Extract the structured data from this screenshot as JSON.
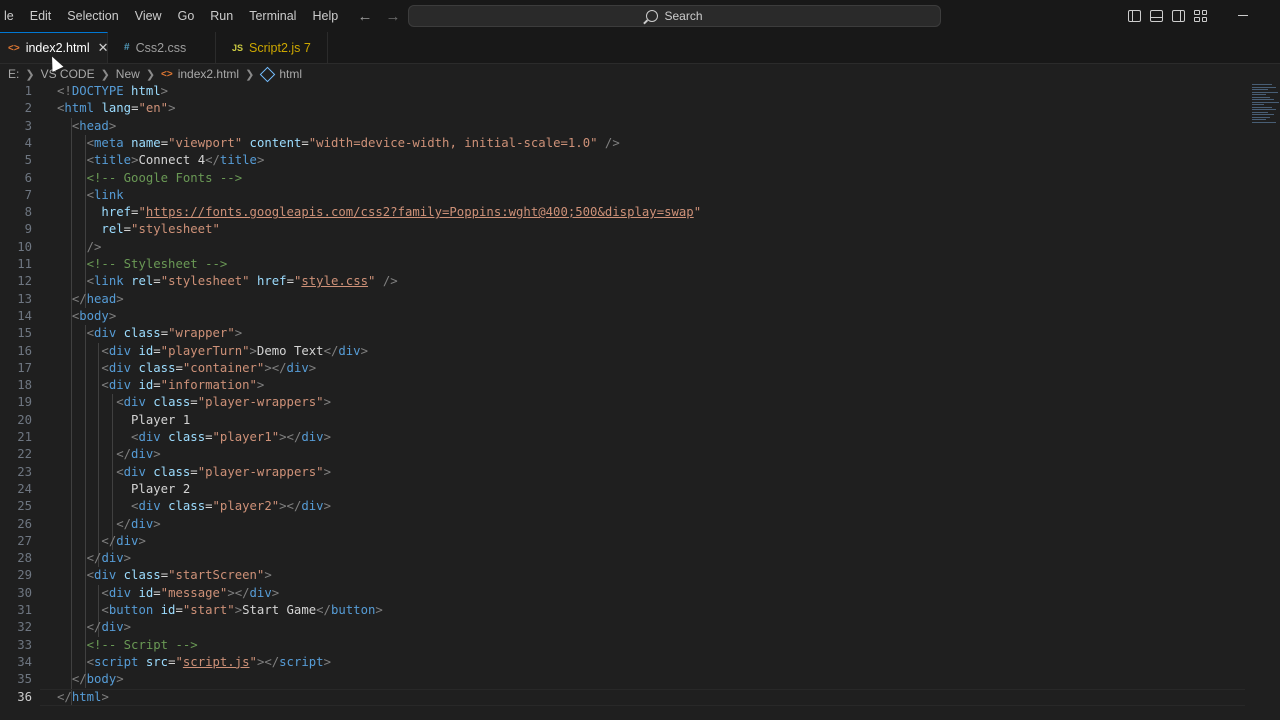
{
  "menu": [
    "le",
    "Edit",
    "Selection",
    "View",
    "Go",
    "Run",
    "Terminal",
    "Help"
  ],
  "search": {
    "label": "Search"
  },
  "tabs": [
    {
      "label": "index2.html",
      "icon": "html-file-icon",
      "active": true
    },
    {
      "label": "Css2.css",
      "icon": "css-file-icon",
      "active": false
    },
    {
      "label": "Script2.js 7",
      "icon": "js-file-icon",
      "active": false
    }
  ],
  "breadcrumb": [
    "E:",
    "VS CODE",
    "New",
    "index2.html",
    "html"
  ],
  "current_line": 36,
  "code": [
    [
      [
        "t",
        "<!"
      ],
      [
        "n",
        "DOCTYPE"
      ],
      [
        "x",
        " "
      ],
      [
        "a",
        "html"
      ],
      [
        "t",
        ">"
      ]
    ],
    [
      [
        "t",
        "<"
      ],
      [
        "n",
        "html"
      ],
      [
        "x",
        " "
      ],
      [
        "a",
        "lang"
      ],
      [
        "x",
        "="
      ],
      [
        "s",
        "\"en\""
      ],
      [
        "t",
        ">"
      ]
    ],
    [
      [
        "x",
        "  "
      ],
      [
        "t",
        "<"
      ],
      [
        "n",
        "head"
      ],
      [
        "t",
        ">"
      ]
    ],
    [
      [
        "x",
        "    "
      ],
      [
        "t",
        "<"
      ],
      [
        "n",
        "meta"
      ],
      [
        "x",
        " "
      ],
      [
        "a",
        "name"
      ],
      [
        "x",
        "="
      ],
      [
        "s",
        "\"viewport\""
      ],
      [
        "x",
        " "
      ],
      [
        "a",
        "content"
      ],
      [
        "x",
        "="
      ],
      [
        "s",
        "\"width=device-width, initial-scale=1.0\""
      ],
      [
        "x",
        " "
      ],
      [
        "t",
        "/>"
      ]
    ],
    [
      [
        "x",
        "    "
      ],
      [
        "t",
        "<"
      ],
      [
        "n",
        "title"
      ],
      [
        "t",
        ">"
      ],
      [
        "x",
        "Connect 4"
      ],
      [
        "t",
        "</"
      ],
      [
        "n",
        "title"
      ],
      [
        "t",
        ">"
      ]
    ],
    [
      [
        "x",
        "    "
      ],
      [
        "c",
        "<!-- Google Fonts -->"
      ]
    ],
    [
      [
        "x",
        "    "
      ],
      [
        "t",
        "<"
      ],
      [
        "n",
        "link"
      ]
    ],
    [
      [
        "x",
        "      "
      ],
      [
        "a",
        "href"
      ],
      [
        "x",
        "="
      ],
      [
        "s",
        "\""
      ],
      [
        "u",
        "https://fonts.googleapis.com/css2?family=Poppins:wght@400;500&display=swap"
      ],
      [
        "s",
        "\""
      ]
    ],
    [
      [
        "x",
        "      "
      ],
      [
        "a",
        "rel"
      ],
      [
        "x",
        "="
      ],
      [
        "s",
        "\"stylesheet\""
      ]
    ],
    [
      [
        "x",
        "    "
      ],
      [
        "t",
        "/>"
      ]
    ],
    [
      [
        "x",
        "    "
      ],
      [
        "c",
        "<!-- Stylesheet -->"
      ]
    ],
    [
      [
        "x",
        "    "
      ],
      [
        "t",
        "<"
      ],
      [
        "n",
        "link"
      ],
      [
        "x",
        " "
      ],
      [
        "a",
        "rel"
      ],
      [
        "x",
        "="
      ],
      [
        "s",
        "\"stylesheet\""
      ],
      [
        "x",
        " "
      ],
      [
        "a",
        "href"
      ],
      [
        "x",
        "="
      ],
      [
        "s",
        "\""
      ],
      [
        "u",
        "style.css"
      ],
      [
        "s",
        "\""
      ],
      [
        "x",
        " "
      ],
      [
        "t",
        "/>"
      ]
    ],
    [
      [
        "x",
        "  "
      ],
      [
        "t",
        "</"
      ],
      [
        "n",
        "head"
      ],
      [
        "t",
        ">"
      ]
    ],
    [
      [
        "x",
        "  "
      ],
      [
        "t",
        "<"
      ],
      [
        "n",
        "body"
      ],
      [
        "t",
        ">"
      ]
    ],
    [
      [
        "x",
        "    "
      ],
      [
        "t",
        "<"
      ],
      [
        "n",
        "div"
      ],
      [
        "x",
        " "
      ],
      [
        "a",
        "class"
      ],
      [
        "x",
        "="
      ],
      [
        "s",
        "\"wrapper\""
      ],
      [
        "t",
        ">"
      ]
    ],
    [
      [
        "x",
        "      "
      ],
      [
        "t",
        "<"
      ],
      [
        "n",
        "div"
      ],
      [
        "x",
        " "
      ],
      [
        "a",
        "id"
      ],
      [
        "x",
        "="
      ],
      [
        "s",
        "\"playerTurn\""
      ],
      [
        "t",
        ">"
      ],
      [
        "x",
        "Demo Text"
      ],
      [
        "t",
        "</"
      ],
      [
        "n",
        "div"
      ],
      [
        "t",
        ">"
      ]
    ],
    [
      [
        "x",
        "      "
      ],
      [
        "t",
        "<"
      ],
      [
        "n",
        "div"
      ],
      [
        "x",
        " "
      ],
      [
        "a",
        "class"
      ],
      [
        "x",
        "="
      ],
      [
        "s",
        "\"container\""
      ],
      [
        "t",
        "></"
      ],
      [
        "n",
        "div"
      ],
      [
        "t",
        ">"
      ]
    ],
    [
      [
        "x",
        "      "
      ],
      [
        "t",
        "<"
      ],
      [
        "n",
        "div"
      ],
      [
        "x",
        " "
      ],
      [
        "a",
        "id"
      ],
      [
        "x",
        "="
      ],
      [
        "s",
        "\"information\""
      ],
      [
        "t",
        ">"
      ]
    ],
    [
      [
        "x",
        "        "
      ],
      [
        "t",
        "<"
      ],
      [
        "n",
        "div"
      ],
      [
        "x",
        " "
      ],
      [
        "a",
        "class"
      ],
      [
        "x",
        "="
      ],
      [
        "s",
        "\"player-wrappers\""
      ],
      [
        "t",
        ">"
      ]
    ],
    [
      [
        "x",
        "          Player 1"
      ]
    ],
    [
      [
        "x",
        "          "
      ],
      [
        "t",
        "<"
      ],
      [
        "n",
        "div"
      ],
      [
        "x",
        " "
      ],
      [
        "a",
        "class"
      ],
      [
        "x",
        "="
      ],
      [
        "s",
        "\"player1\""
      ],
      [
        "t",
        "></"
      ],
      [
        "n",
        "div"
      ],
      [
        "t",
        ">"
      ]
    ],
    [
      [
        "x",
        "        "
      ],
      [
        "t",
        "</"
      ],
      [
        "n",
        "div"
      ],
      [
        "t",
        ">"
      ]
    ],
    [
      [
        "x",
        "        "
      ],
      [
        "t",
        "<"
      ],
      [
        "n",
        "div"
      ],
      [
        "x",
        " "
      ],
      [
        "a",
        "class"
      ],
      [
        "x",
        "="
      ],
      [
        "s",
        "\"player-wrappers\""
      ],
      [
        "t",
        ">"
      ]
    ],
    [
      [
        "x",
        "          Player 2"
      ]
    ],
    [
      [
        "x",
        "          "
      ],
      [
        "t",
        "<"
      ],
      [
        "n",
        "div"
      ],
      [
        "x",
        " "
      ],
      [
        "a",
        "class"
      ],
      [
        "x",
        "="
      ],
      [
        "s",
        "\"player2\""
      ],
      [
        "t",
        "></"
      ],
      [
        "n",
        "div"
      ],
      [
        "t",
        ">"
      ]
    ],
    [
      [
        "x",
        "        "
      ],
      [
        "t",
        "</"
      ],
      [
        "n",
        "div"
      ],
      [
        "t",
        ">"
      ]
    ],
    [
      [
        "x",
        "      "
      ],
      [
        "t",
        "</"
      ],
      [
        "n",
        "div"
      ],
      [
        "t",
        ">"
      ]
    ],
    [
      [
        "x",
        "    "
      ],
      [
        "t",
        "</"
      ],
      [
        "n",
        "div"
      ],
      [
        "t",
        ">"
      ]
    ],
    [
      [
        "x",
        "    "
      ],
      [
        "t",
        "<"
      ],
      [
        "n",
        "div"
      ],
      [
        "x",
        " "
      ],
      [
        "a",
        "class"
      ],
      [
        "x",
        "="
      ],
      [
        "s",
        "\"startScreen\""
      ],
      [
        "t",
        ">"
      ]
    ],
    [
      [
        "x",
        "      "
      ],
      [
        "t",
        "<"
      ],
      [
        "n",
        "div"
      ],
      [
        "x",
        " "
      ],
      [
        "a",
        "id"
      ],
      [
        "x",
        "="
      ],
      [
        "s",
        "\"message\""
      ],
      [
        "t",
        "></"
      ],
      [
        "n",
        "div"
      ],
      [
        "t",
        ">"
      ]
    ],
    [
      [
        "x",
        "      "
      ],
      [
        "t",
        "<"
      ],
      [
        "n",
        "button"
      ],
      [
        "x",
        " "
      ],
      [
        "a",
        "id"
      ],
      [
        "x",
        "="
      ],
      [
        "s",
        "\"start\""
      ],
      [
        "t",
        ">"
      ],
      [
        "x",
        "Start Game"
      ],
      [
        "t",
        "</"
      ],
      [
        "n",
        "button"
      ],
      [
        "t",
        ">"
      ]
    ],
    [
      [
        "x",
        "    "
      ],
      [
        "t",
        "</"
      ],
      [
        "n",
        "div"
      ],
      [
        "t",
        ">"
      ]
    ],
    [
      [
        "x",
        "    "
      ],
      [
        "c",
        "<!-- Script -->"
      ]
    ],
    [
      [
        "x",
        "    "
      ],
      [
        "t",
        "<"
      ],
      [
        "n",
        "script"
      ],
      [
        "x",
        " "
      ],
      [
        "a",
        "src"
      ],
      [
        "x",
        "="
      ],
      [
        "s",
        "\""
      ],
      [
        "u",
        "script.js"
      ],
      [
        "s",
        "\""
      ],
      [
        "t",
        "></"
      ],
      [
        "n",
        "script"
      ],
      [
        "t",
        ">"
      ]
    ],
    [
      [
        "x",
        "  "
      ],
      [
        "t",
        "</"
      ],
      [
        "n",
        "body"
      ],
      [
        "t",
        ">"
      ]
    ],
    [
      [
        "t",
        "</"
      ],
      [
        "n",
        "html"
      ],
      [
        "t",
        ">"
      ]
    ]
  ]
}
